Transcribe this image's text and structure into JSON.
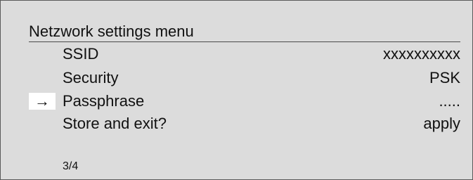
{
  "menu": {
    "title": "Netzwork settings menu",
    "cursor_glyph": "→",
    "selected_index": 2,
    "items": [
      {
        "label": "SSID",
        "value": "xxxxxxxxxx"
      },
      {
        "label": "Security",
        "value": "PSK"
      },
      {
        "label": "Passphrase",
        "value": "....."
      },
      {
        "label": "Store and exit?",
        "value": "apply"
      }
    ],
    "page_indicator": "3/4"
  },
  "colors": {
    "background": "#dcdcdc",
    "text": "#111111",
    "cursor_highlight": "#ffffff",
    "rule": "#4a4a4a"
  }
}
